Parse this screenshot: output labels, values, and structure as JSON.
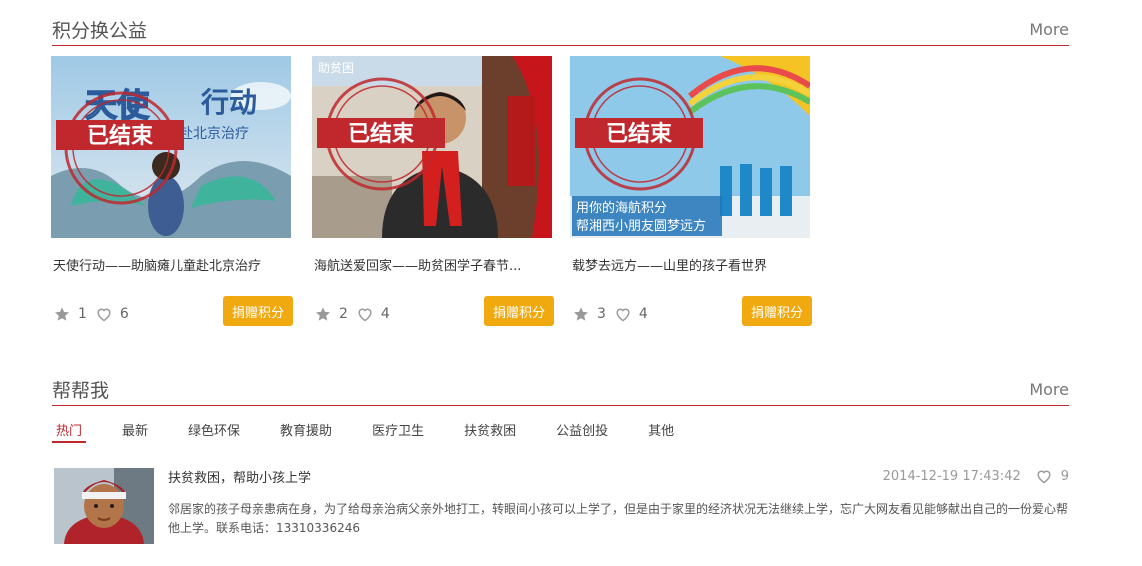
{
  "section1": {
    "title": "积分换公益",
    "more": "More"
  },
  "projects": [
    {
      "stamp": "已结束",
      "image_text_1": "天使",
      "image_text_2": "行动",
      "image_text_3": "赴北京治疗",
      "title": "天使行动——助脑瘫儿童赴北京治疗",
      "stars": "1",
      "likes": "6",
      "button": "捐赠积分"
    },
    {
      "stamp": "已结束",
      "image_text_1": "助贫困",
      "title": "海航送爱回家——助贫困学子春节...",
      "stars": "2",
      "likes": "4",
      "button": "捐赠积分"
    },
    {
      "stamp": "已结束",
      "image_text_1": "用你的海航积分",
      "image_text_2": "帮湘西小朋友圆梦远方",
      "title": "载梦去远方——山里的孩子看世界",
      "stars": "3",
      "likes": "4",
      "button": "捐赠积分"
    }
  ],
  "section2": {
    "title": "帮帮我",
    "more": "More"
  },
  "tabs": [
    "热门",
    "最新",
    "绿色环保",
    "教育援助",
    "医疗卫生",
    "扶贫救困",
    "公益创投",
    "其他"
  ],
  "help_item": {
    "title": "扶贫救困，帮助小孩上学",
    "datetime": "2014-12-19 17:43:42",
    "likes": "9",
    "description": "邻居家的孩子母亲患病在身，为了给母亲治病父亲外地打工，转眼间小孩可以上学了，但是由于家里的经济状况无法继续上学，忘广大网友看见能够献出自己的一份爱心帮他上学。联系电话：13310336246"
  },
  "colors": {
    "accent": "#c0282e",
    "button": "#f0a90f"
  },
  "icons": {
    "star": "star-icon",
    "heart": "heart-icon"
  }
}
